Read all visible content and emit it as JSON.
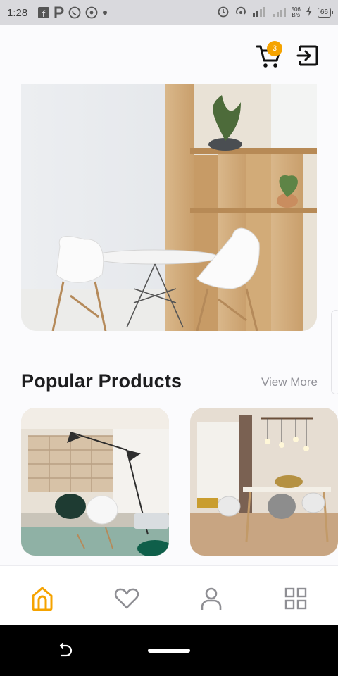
{
  "status_bar": {
    "time": "1:28",
    "net_speed_top": "506",
    "net_speed_bottom": "B/s",
    "battery": "66"
  },
  "header": {
    "cart_count": "3"
  },
  "section": {
    "title": "Popular Products",
    "view_more": "View More"
  },
  "colors": {
    "accent": "#f5a300",
    "nav_inactive": "#8e8e93",
    "title": "#1d1d1f"
  },
  "icons": {
    "cart": "cart-icon",
    "logout": "logout-icon",
    "home": "home-icon",
    "favorite": "heart-icon",
    "profile": "user-icon",
    "categories": "grid-icon"
  }
}
